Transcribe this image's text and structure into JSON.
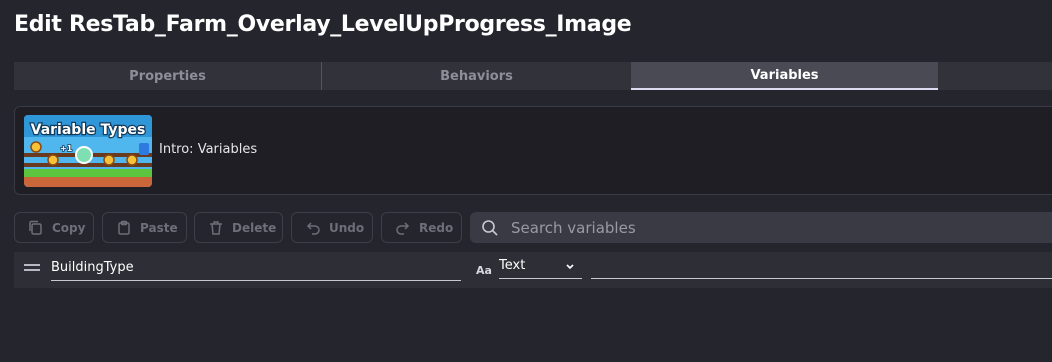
{
  "window": {
    "title": "Edit ResTab_Farm_Overlay_LevelUpProgress_Image"
  },
  "tabs": [
    {
      "label": "Properties",
      "active": false
    },
    {
      "label": "Behaviors",
      "active": false
    },
    {
      "label": "Variables",
      "active": true
    }
  ],
  "tutorial": {
    "thumbnail_caption": "Variable Types",
    "thumbnail_badge": "+1",
    "label": "Intro: Variables"
  },
  "toolbar": {
    "copy": "Copy",
    "paste": "Paste",
    "delete": "Delete",
    "undo": "Undo",
    "redo": "Redo"
  },
  "search": {
    "placeholder": "Search variables",
    "value": ""
  },
  "variables": [
    {
      "name": "BuildingType",
      "type": "Text",
      "type_icon": "Aa",
      "value": ""
    }
  ],
  "colors": {
    "background": "#25252d",
    "tab_bar": "#32323b",
    "tab_active": "#4a4a55",
    "accent_underline": "#dcdcf0"
  },
  "icons": {
    "copy": "copy-icon",
    "paste": "clipboard-icon",
    "delete": "trash-icon",
    "undo": "undo-icon",
    "redo": "redo-icon",
    "search": "search-icon",
    "drag": "drag-handle-icon",
    "type": "text-type-icon",
    "dropdown": "chevron-down-icon"
  }
}
